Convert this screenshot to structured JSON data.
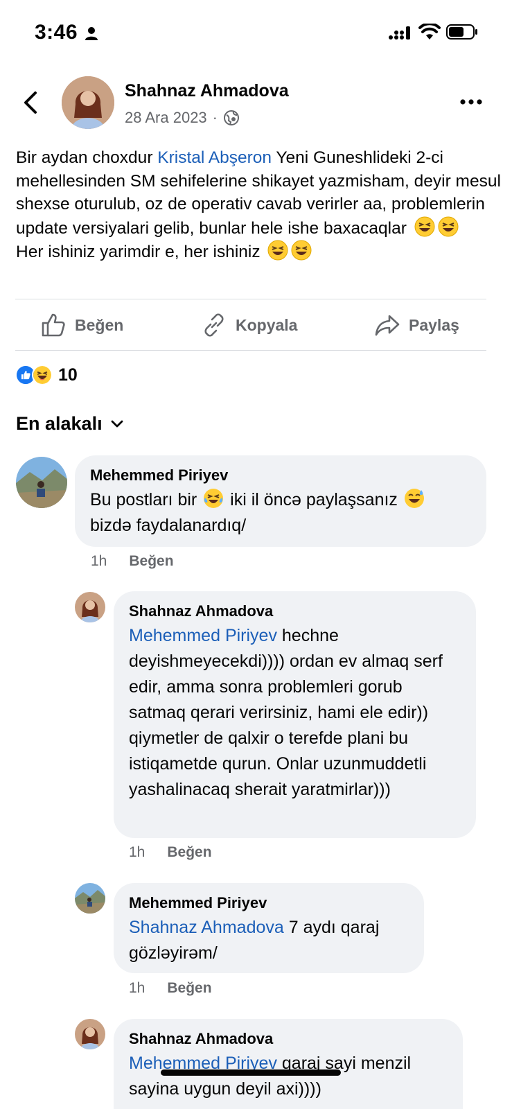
{
  "status_bar": {
    "time": "3:46"
  },
  "post": {
    "author": "Shahnaz Ahmadova",
    "date": "28 Ara 2023",
    "separator": "·",
    "text_part1": "Bir aydan choxdur ",
    "mention": "Kristal Abşeron",
    "text_part2": " Yeni Guneshlideki 2-ci mehellesinden SM sehifelerine shikayet yazmisham, deyir mesul shexse oturulub, oz de operativ cavab verirler aa, problemlerin update versiyalari gelib, bunlar hele ishe baxacaqlar",
    "text_part3": "Her ishiniz yarimdir e, her ishiniz"
  },
  "actions": {
    "like": "Beğen",
    "copy": "Kopyala",
    "share": "Paylaş"
  },
  "reactions": {
    "count": "10"
  },
  "sort": {
    "label": "En alakalı"
  },
  "comments": [
    {
      "author": "Mehemmed Piriyev",
      "text_before": "Bu postları bir ",
      "text_mid": " iki il öncə paylaşsanız ",
      "text_after": " bizdə faydalanardıq/",
      "time": "1h",
      "like": "Beğen"
    },
    {
      "author": "Shahnaz Ahmadova",
      "mention": "Mehemmed Piriyev",
      "text": " hechne deyishmeyecekdi)))) ordan ev almaq serf edir, amma sonra problemleri gorub satmaq qerari verirsiniz, hami ele edir)) qiymetler de qalxir o terefde plani bu istiqametde qurun. Onlar uzunmuddetli yashalinacaq sherait yaratmirlar)))",
      "time": "1h",
      "like": "Beğen"
    },
    {
      "author": "Mehemmed Piriyev",
      "mention": "Shahnaz Ahmadova",
      "text": " 7 aydı qaraj gözləyirəm/",
      "time": "1h",
      "like": "Beğen"
    },
    {
      "author": "Shahnaz Ahmadova",
      "mention": "Mehemmed Piriyev",
      "text": " qaraj sayi menzil sayina uygun deyil axi))))"
    }
  ],
  "colors": {
    "link": "#1c5fb8",
    "muted": "#65676b",
    "bubble": "#f0f2f5",
    "like_blue": "#1877f2"
  }
}
